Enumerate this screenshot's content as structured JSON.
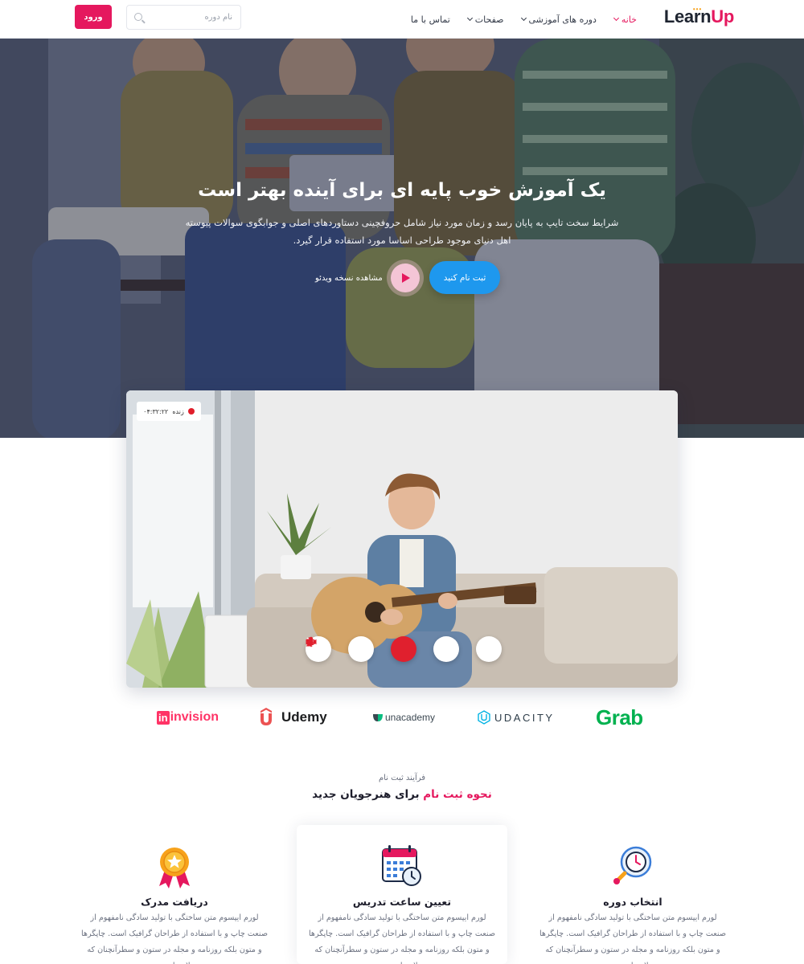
{
  "header": {
    "logo": {
      "part1": "Learn",
      "part2": "Up"
    },
    "nav": [
      {
        "label": "خانه",
        "has_dropdown": true,
        "active": true
      },
      {
        "label": "دوره های آموزشی",
        "has_dropdown": true,
        "active": false
      },
      {
        "label": "صفحات",
        "has_dropdown": true,
        "active": false
      },
      {
        "label": "تماس با ما",
        "has_dropdown": false,
        "active": false
      }
    ],
    "search": {
      "placeholder": "نام دوره",
      "value": ""
    },
    "login_label": "ورود"
  },
  "hero": {
    "title": "یک آموزش خوب پایه ای برای آینده بهتر است",
    "description": "شرایط سخت تایپ به پایان رسد و زمان مورد نیاز شامل حروفچینی دستاوردهای اصلی و جوابگوی سوالات پیوسته اهل دنیای موجود طراحی اساسا مورد استفاده قرار گیرد.",
    "signup_label": "ثبت نام کنید",
    "video_link_label": "مشاهده نسخه ویدئو"
  },
  "video": {
    "live_label": "زنده",
    "live_time": "۰۴:۳۲:۲۲",
    "controls": [
      "add-user-icon",
      "speaker-icon",
      "hangup-icon",
      "camera-icon",
      "microphone-icon"
    ]
  },
  "partners": [
    "invision",
    "Udemy",
    "unacademy",
    "UDACITY",
    "Grab"
  ],
  "process": {
    "kicker": "فرآیند ثبت نام",
    "title_highlight": "نحوه ثبت نام",
    "title_rest": "برای هنرجویان جدید",
    "steps": [
      {
        "title": "انتخاب دوره",
        "text": "لورم ایپسوم متن ساختگی با تولید سادگی نامفهوم از صنعت چاپ و با استفاده از طراحان گرافیک است. چاپگرها و متون بلکه روزنامه و مجله در ستون و سطرآنچنان که لازم است",
        "icon": "target-clock-icon"
      },
      {
        "title": "تعیین ساعت تدریس",
        "text": "لورم ایپسوم متن ساختگی با تولید سادگی نامفهوم از صنعت چاپ و با استفاده از طراحان گرافیک است. چاپگرها و متون بلکه روزنامه و مجله در ستون و سطرآنچنان که لازم است",
        "icon": "calendar-clock-icon"
      },
      {
        "title": "دریافت مدرک",
        "text": "لورم ایپسوم متن ساختگی با تولید سادگی نامفهوم از صنعت چاپ و با استفاده از طراحان گرافیک است. چاپگرها و متون بلکه روزنامه و مجله در ستون و سطرآنچنان که لازم است",
        "icon": "award-medal-icon"
      }
    ]
  },
  "colors": {
    "accent": "#e5185e",
    "primary_button": "#1e98ee",
    "dark_text": "#1d1d2b"
  }
}
